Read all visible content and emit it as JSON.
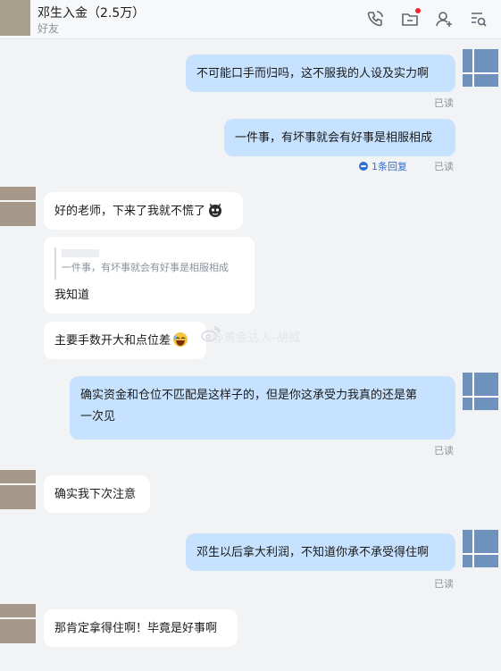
{
  "header": {
    "title": "邓生入金（2.5万）",
    "subtitle": "好友"
  },
  "messages": {
    "m1": "不可能口手而归吗，这不服我的人设及实力啊",
    "m1_status": "已读",
    "m2": "一件事，有坏事就会有好事是相服相成",
    "m2_reply": "1条回复",
    "m2_status": "已读",
    "m3": "好的老师，下来了我就不慌了",
    "m4_quote": "一件事，有坏事就会有好事是相服相成",
    "m4": "我知道",
    "m5": "主要手数开大和点位差",
    "m6_line1": "确实资金和仓位不匹配是这样子的，但是你这承受力我真的还是第",
    "m6_line2": "一次见",
    "m6_status": "已读",
    "m7": "确实我下次注意",
    "m8": "邓生以后拿大利润，不知道你承不承受得住啊",
    "m8_status": "已读",
    "m9": "那肯定拿得住啊！毕竟是好事啊"
  },
  "watermark": "@黄金达人-胡威",
  "icons": [
    "phone-icon",
    "folder-icon",
    "add-friend-icon",
    "search-chat-icon",
    "settings-icon"
  ],
  "colors": {
    "bubble_out": "#c7e2ff",
    "bubble_in": "#ffffff",
    "background": "#f2f3f5",
    "link": "#2f6fd6",
    "notification": "#f5222d"
  }
}
